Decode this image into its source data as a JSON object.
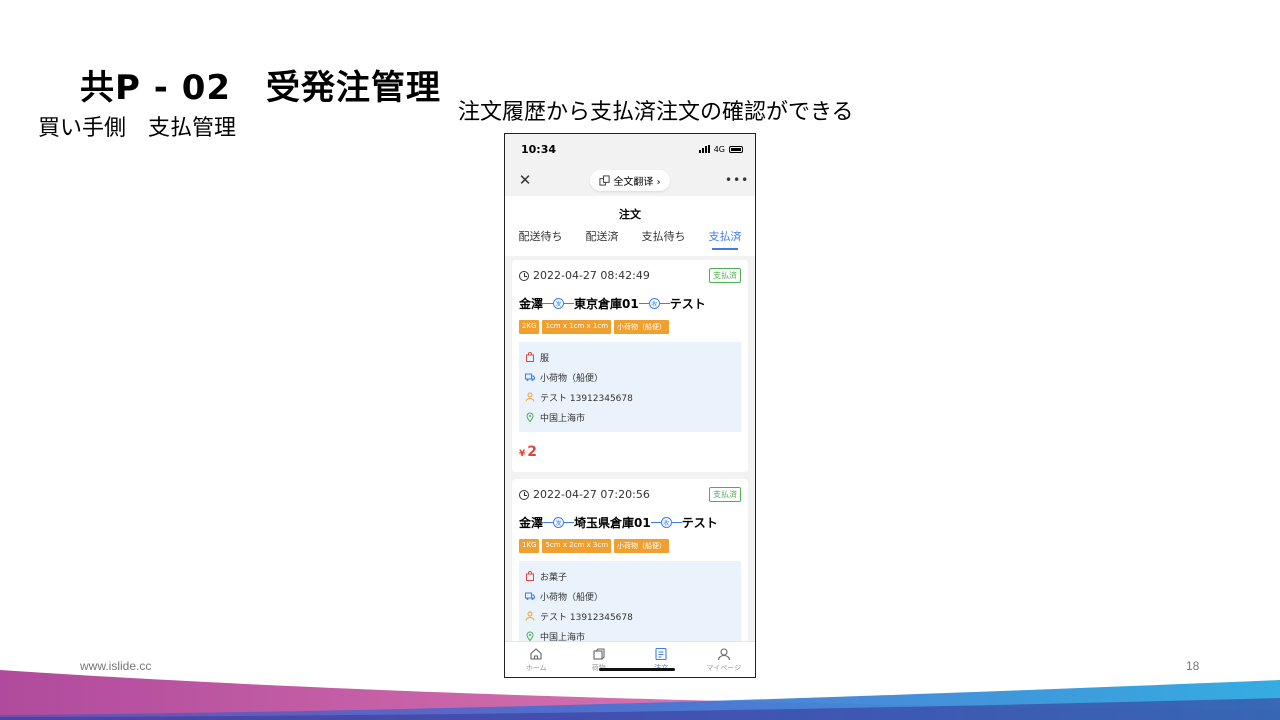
{
  "slide": {
    "title": "共P - 02　受発注管理",
    "subtitle": "買い手側　支払管理",
    "caption": "注文履歴から支払済注文の確認ができる",
    "footer_url": "www.islide.cc",
    "page_number": "18"
  },
  "phone": {
    "status_bar": {
      "time": "10:34",
      "network": "4G"
    },
    "nav": {
      "translate_label": "全文翻译 ›"
    },
    "heading": "注文",
    "tabs": [
      {
        "label": "配送待ち",
        "active": false
      },
      {
        "label": "配送済",
        "active": false
      },
      {
        "label": "支払待ち",
        "active": false
      },
      {
        "label": "支払済",
        "active": true
      }
    ],
    "orders": [
      {
        "datetime": "2022-04-27 08:42:49",
        "status": "支払済",
        "origin": "金澤",
        "route_mark_1": "发",
        "warehouse": "東京倉庫01",
        "route_mark_2": "收",
        "destination": "テスト",
        "tags": [
          "2KG",
          "1cm x 1cm x 1cm",
          "小荷物（船便）"
        ],
        "item": "服",
        "shipping": "小荷物（船便）",
        "contact": "テスト 13912345678",
        "address": "中国上海市",
        "currency": "¥",
        "price": "2"
      },
      {
        "datetime": "2022-04-27 07:20:56",
        "status": "支払済",
        "origin": "金澤",
        "route_mark_1": "发",
        "warehouse": "埼玉県倉庫01",
        "route_mark_2": "收",
        "destination": "テスト",
        "tags": [
          "1KG",
          "5cm x 2cm x 3cm",
          "小荷物（船便）"
        ],
        "item": "お菓子",
        "shipping": "小荷物（船便）",
        "contact": "テスト 13912345678",
        "address": "中国上海市"
      }
    ],
    "bottom_nav": [
      {
        "label": "ホーム",
        "icon": "home-icon",
        "active": false
      },
      {
        "label": "荷物",
        "icon": "package-icon",
        "active": false
      },
      {
        "label": "注文",
        "icon": "order-icon",
        "active": true
      },
      {
        "label": "マイページ",
        "icon": "user-icon",
        "active": false
      }
    ],
    "colors": {
      "accent": "#3c7cf0",
      "tag": "#f0a030",
      "paid": "#4caf50",
      "price": "#e0463e"
    }
  }
}
